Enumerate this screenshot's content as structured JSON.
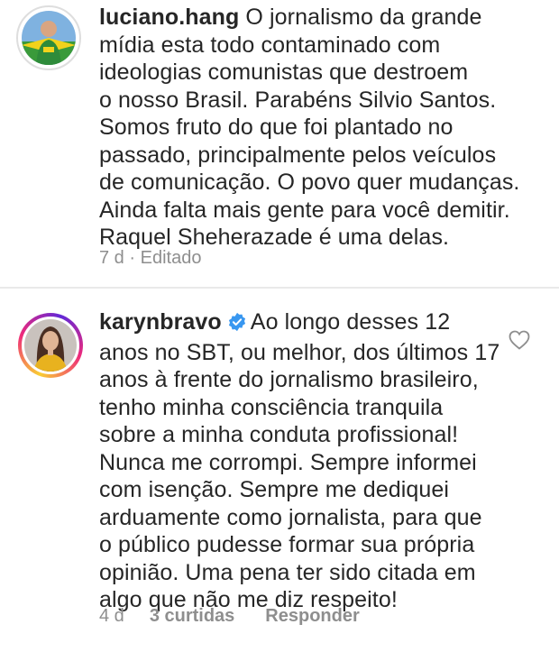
{
  "comments": [
    {
      "username": "luciano.hang",
      "verified": false,
      "lines": [
        "O jornalismo da grande",
        "mídia esta todo contaminado com",
        "ideologias comunistas que destroem",
        "o nosso Brasil. Parabéns Silvio Santos.",
        "Somos fruto do que foi plantado no",
        "passado, principalmente pelos veículos",
        "de comunicação. O povo quer mudanças.",
        "Ainda falta mais gente para você demitir.",
        "Raquel Sheherazade é uma delas."
      ],
      "time": "7 d",
      "separator": "·",
      "edited": "Editado"
    },
    {
      "username": "karynbravo",
      "verified": true,
      "lines": [
        "Ao longo desses 12",
        "anos no SBT, ou melhor, dos últimos 17",
        "anos à frente do jornalismo brasileiro,",
        "tenho minha consciência tranquila",
        "sobre a minha conduta profissional!",
        "Nunca me corrompi. Sempre informei",
        "com isenção. Sempre me dediquei",
        "arduamente como jornalista, para que",
        "o público pudesse formar sua própria",
        "opinião. Uma pena ter sido citada em",
        "algo que não me diz respeito!"
      ],
      "time": "4 d",
      "likes": "3 curtidas",
      "reply": "Responder"
    }
  ],
  "colors": {
    "text": "#262626",
    "meta": "#8e8e8e",
    "verified": "#3897f0",
    "divider": "#e9e9e9"
  },
  "icons": {
    "like": "heart-outline-icon",
    "verified": "verified-badge-icon"
  }
}
